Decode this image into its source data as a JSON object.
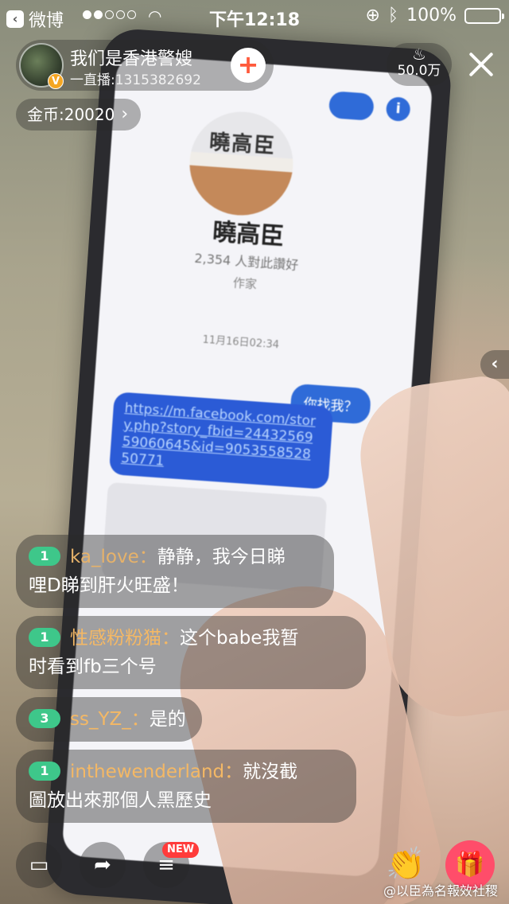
{
  "status_bar": {
    "back_app": "微博",
    "time": "下午12:18",
    "battery": "100%",
    "signal_dots_on": 2,
    "signal_dots_total": 5
  },
  "streamer": {
    "name": "我们是香港警嫂",
    "id_line": "一直播:1315382692",
    "follow_symbol": "+",
    "verified_symbol": "V"
  },
  "viewers": {
    "count": "50.0万",
    "icon": "flame-icon"
  },
  "coins": {
    "label": "金币:20020",
    "chevron": "›"
  },
  "video_frame": {
    "fb_page_name": "曉高臣",
    "fb_avatar_text": "曉高臣",
    "fb_likes": "2,354 人對此讚好",
    "fb_role": "作家",
    "fb_timestamp": "11月16日02:34",
    "fb_my_message": "你找我？",
    "fb_link": "https://m.facebook.com/story.php?story_fbid=2443256959060645&id=905355852850771"
  },
  "comments": [
    {
      "level": "1",
      "user": "ka_love",
      "sep": "：",
      "text_line1": "静静，我今日睇",
      "text_line2": "哩D睇到肝火旺盛！"
    },
    {
      "level": "1",
      "user": "性感粉粉猫",
      "sep": "：",
      "text_line1": "这个babe我暂",
      "text_line2": "时看到fb三个号"
    },
    {
      "level": "3",
      "user": "ss_YZ_",
      "sep": "：",
      "text_line1": "是的",
      "text_line2": ""
    },
    {
      "level": "1",
      "user": "inthewenderland",
      "sep": "：",
      "text_line1": "就沒截",
      "text_line2": "圖放出來那個人黑歷史"
    }
  ],
  "bottom_bar": {
    "new_badge": "NEW",
    "watermark": "@以臣為名報效社稷"
  },
  "colors": {
    "follow_plus": "#ff5a3c",
    "level_badge": "#3ec78a",
    "username": "#f4b865",
    "gift_button": "#ff4d6a",
    "new_badge": "#ff3b3b"
  }
}
